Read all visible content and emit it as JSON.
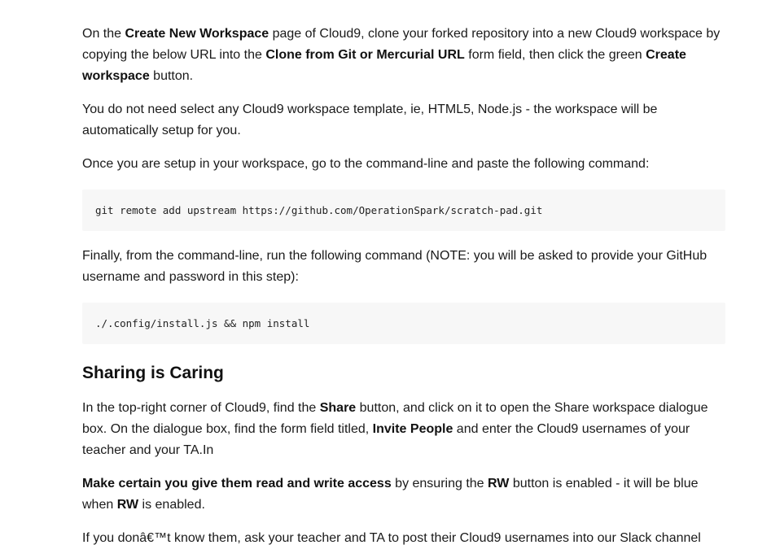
{
  "p1": {
    "t1": "On the ",
    "b1": "Create New Workspace",
    "t2": " page of Cloud9, clone your forked repository into a new Cloud9 workspace by copying the below URL into the ",
    "b2": "Clone from Git or Mercurial URL",
    "t3": " form field, then click the green ",
    "b3": "Create workspace",
    "t4": " button."
  },
  "p2": "You do not need select any Cloud9 workspace template, ie, HTML5, Node.js - the workspace will be automatically setup for you.",
  "p3": "Once you are setup in your workspace, go to the command-line and paste the following command:",
  "code1": "git remote add upstream https://github.com/OperationSpark/scratch-pad.git",
  "p4": "Finally, from the command-line, run the following command (NOTE: you will be asked to provide your GitHub username and password in this step):",
  "code2": "./.config/install.js && npm install",
  "heading": "Sharing is Caring",
  "p5": {
    "t1": "In the top-right corner of Cloud9, find the ",
    "b1": "Share",
    "t2": " button, and click on it to open the Share workspace dialogue box. On the dialogue box, find the form field titled, ",
    "b2": "Invite People",
    "t3": " and enter the Cloud9 usernames of your teacher and your TA.In"
  },
  "p6": {
    "b1": "Make certain you give them read and write access",
    "t1": " by ensuring the ",
    "b2": "RW",
    "t2": " button is enabled - it will be blue when ",
    "b3": "RW",
    "t3": " is enabled."
  },
  "p7": "If you donâ€™t know them, ask your teacher and TA to post their Cloud9 usernames into our Slack channel"
}
